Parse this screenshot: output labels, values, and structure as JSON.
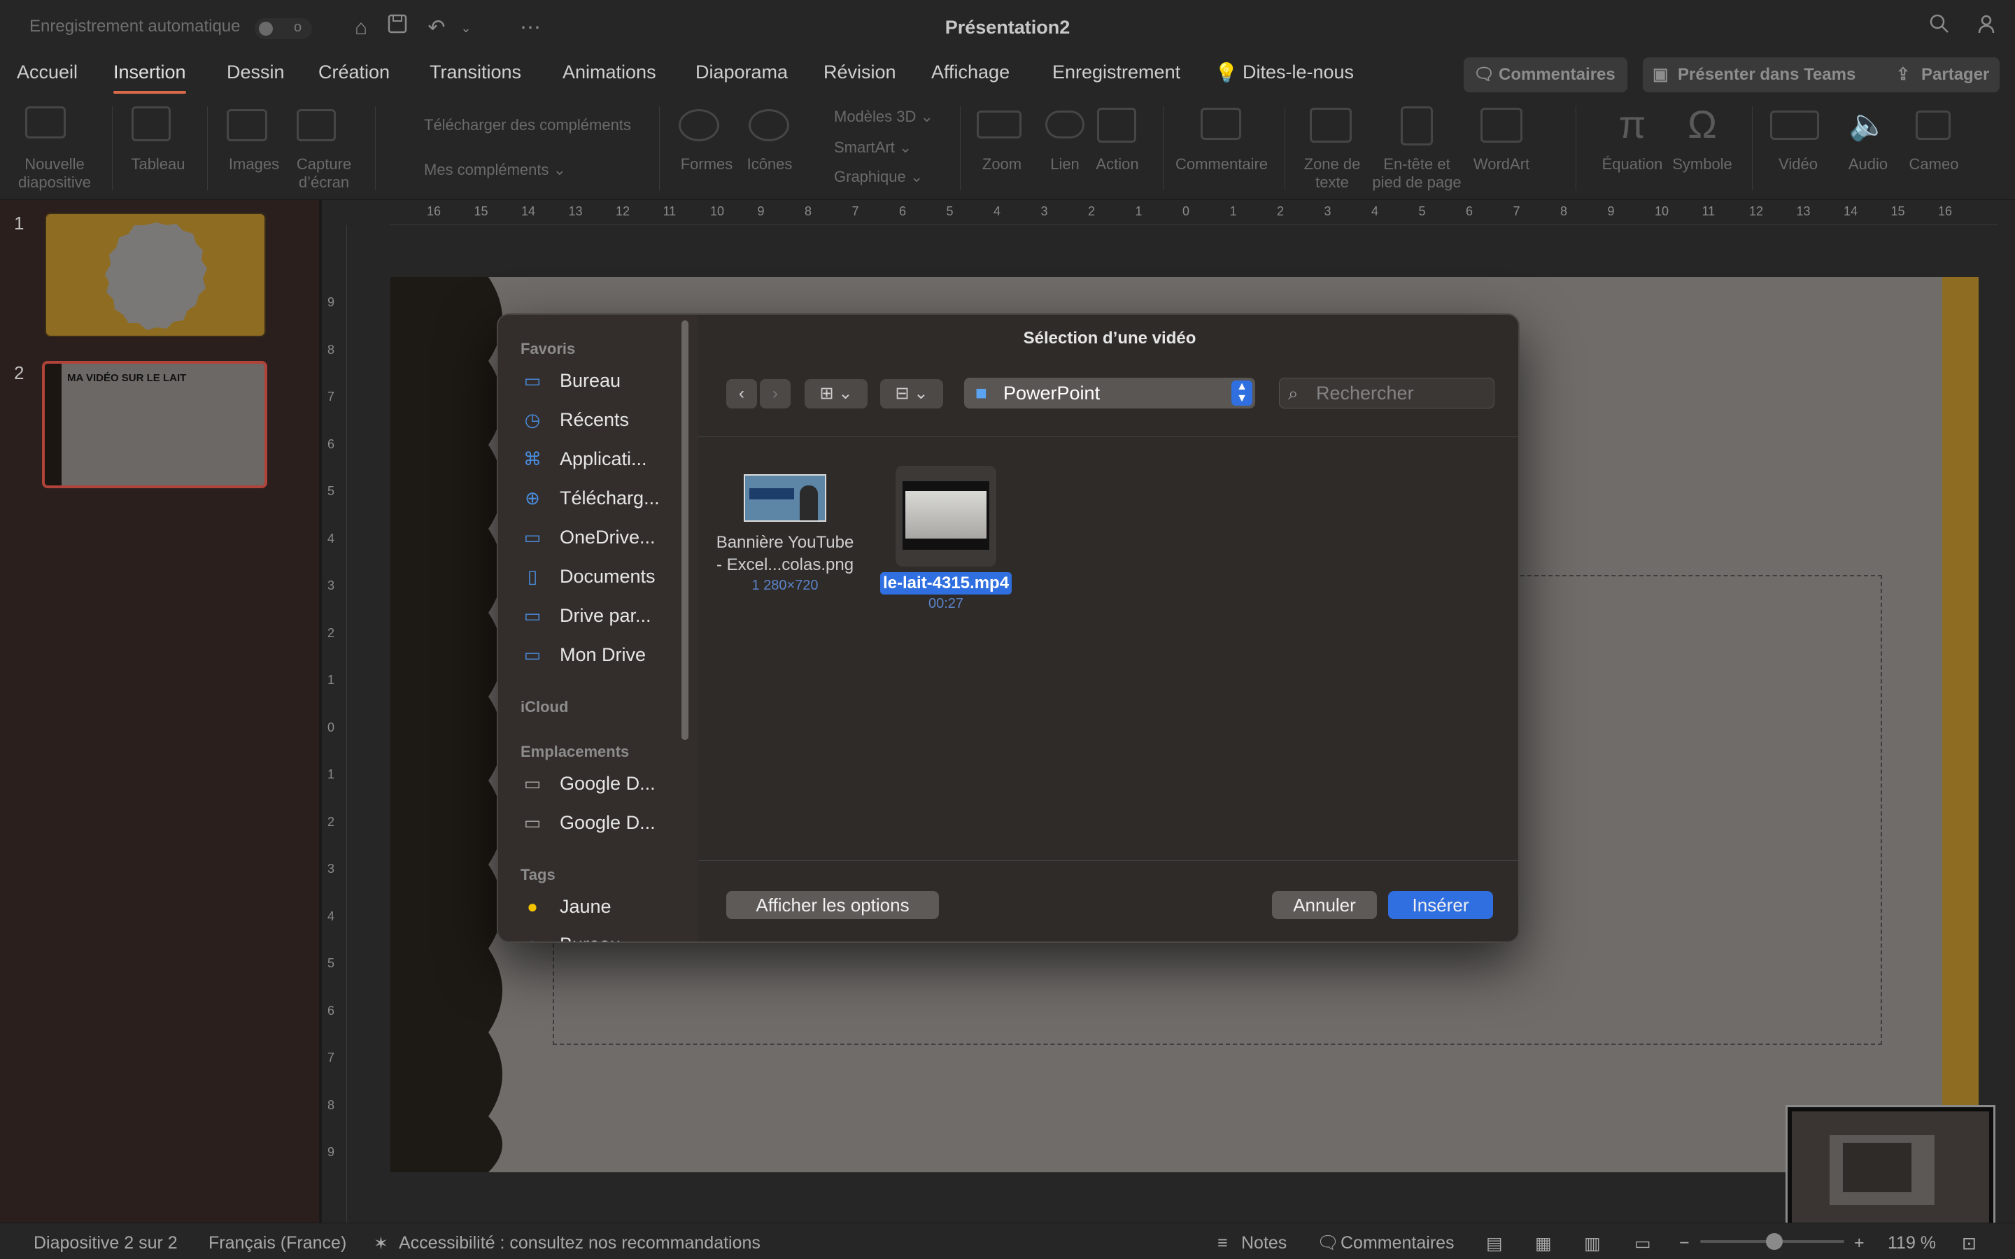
{
  "titlebar": {
    "autosave": "Enregistrement automatique",
    "toggle_state": "o",
    "title": "Présentation2"
  },
  "tabs": [
    "Accueil",
    "Insertion",
    "Dessin",
    "Création",
    "Transitions",
    "Animations",
    "Diaporama",
    "Révision",
    "Affichage",
    "Enregistrement"
  ],
  "tell_me": "Dites-le-nous",
  "toolbar_buttons": {
    "comments": "Commentaires",
    "teams": "Présenter dans Teams",
    "share": "Partager"
  },
  "ribbon": {
    "new_slide": "Nouvelle diapositive",
    "table": "Tableau",
    "images": "Images",
    "screenshot": "Capture d’écran",
    "get_addins": "Télécharger des compléments",
    "my_addins": "Mes compléments",
    "shapes": "Formes",
    "icons": "Icônes",
    "models3d": "Modèles 3D",
    "smartart": "SmartArt",
    "chart": "Graphique",
    "zoom": "Zoom",
    "link": "Lien",
    "action": "Action",
    "comment": "Commentaire",
    "textbox": "Zone de texte",
    "header_footer": "En-tête et pied de page",
    "wordart": "WordArt",
    "equation": "Équation",
    "symbol": "Symbole",
    "video": "Vidéo",
    "audio": "Audio",
    "cameo": "Cameo"
  },
  "ruler_h": [
    "16",
    "15",
    "14",
    "13",
    "12",
    "11",
    "10",
    "9",
    "8",
    "7",
    "6",
    "5",
    "4",
    "3",
    "2",
    "1",
    "0",
    "1",
    "2",
    "3",
    "4",
    "5",
    "6",
    "7",
    "8",
    "9",
    "10",
    "11",
    "12",
    "13",
    "14",
    "15",
    "16"
  ],
  "ruler_v": [
    "9",
    "8",
    "7",
    "6",
    "5",
    "4",
    "3",
    "2",
    "1",
    "0",
    "1",
    "2",
    "3",
    "4",
    "5",
    "6",
    "7",
    "8",
    "9"
  ],
  "slides": [
    {
      "num": "1"
    },
    {
      "num": "2",
      "title": "MA VIDÉO SUR LE LAIT"
    }
  ],
  "dialog": {
    "title": "Sélection d’une vidéo",
    "sections": {
      "favorites": "Favoris",
      "icloud": "iCloud",
      "locations": "Emplacements",
      "tags": "Tags"
    },
    "favorites": [
      "Bureau",
      "Récents",
      "Applicati...",
      "Télécharg...",
      "OneDrive...",
      "Documents",
      "Drive par...",
      "Mon Drive"
    ],
    "locations": [
      "Google D...",
      "Google D..."
    ],
    "tags": [
      "Jaune",
      "Bureau"
    ],
    "path": "PowerPoint",
    "search_placeholder": "Rechercher",
    "files": [
      {
        "name1": "Bannière YouTube",
        "name2": "- Excel...colas.png",
        "meta": "1 280×720"
      },
      {
        "name": "le-lait-4315.mp4",
        "meta": "00:27"
      }
    ],
    "show_options": "Afficher les options",
    "cancel": "Annuler",
    "insert": "Insérer"
  },
  "status": {
    "slide_info": "Diapositive 2 sur 2",
    "language": "Français (France)",
    "accessibility": "Accessibilité : consultez nos recommandations",
    "notes": "Notes",
    "comments": "Commentaires",
    "zoom": "119 %"
  },
  "colors": {
    "accent": "#2f6fe0",
    "active_tab": "#d86a4a",
    "slide_gold": "#c8962e",
    "tag_yellow": "#f2c200"
  }
}
